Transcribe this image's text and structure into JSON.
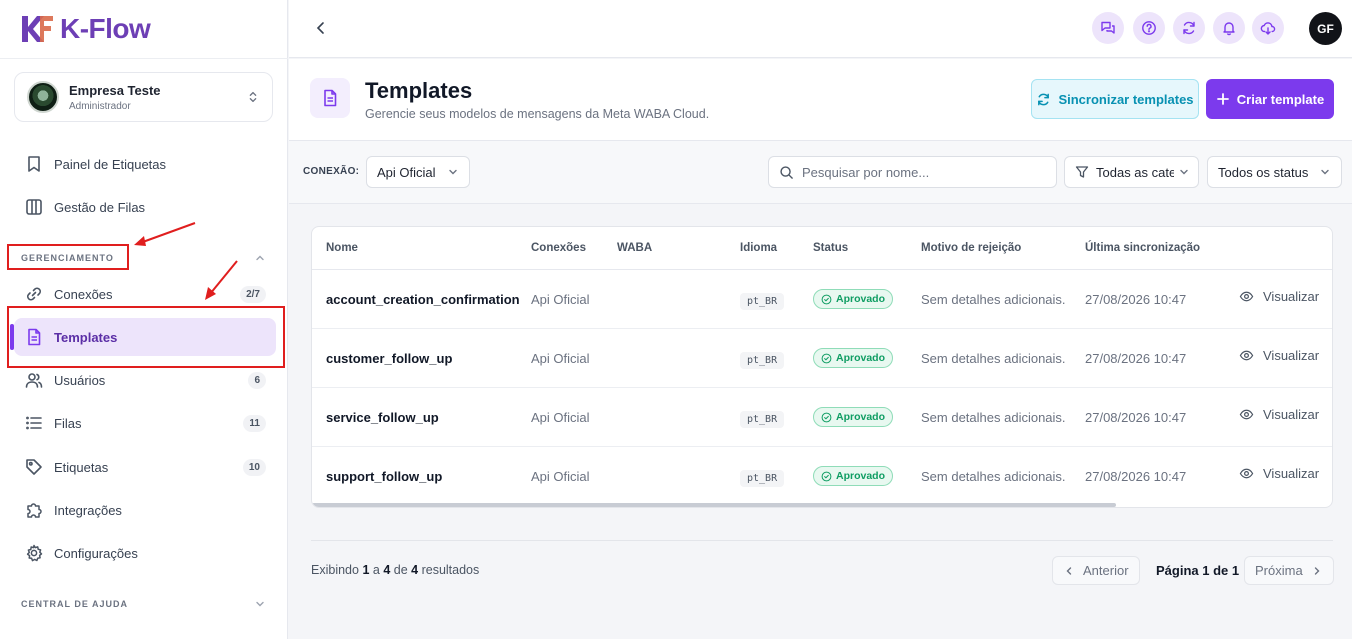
{
  "app": {
    "logo_text": "K-Flow"
  },
  "company": {
    "name": "Empresa Teste",
    "role": "Administrador"
  },
  "sidebar": {
    "top_items": [
      {
        "label": "Painel de Etiquetas",
        "icon": "bookmark-icon"
      },
      {
        "label": "Gestão de Filas",
        "icon": "columns-icon"
      }
    ],
    "section_management": "GERENCIAMENTO",
    "items": [
      {
        "label": "Conexões",
        "badge": "2/7",
        "icon": "link-icon"
      },
      {
        "label": "Templates",
        "badge": "",
        "icon": "document-icon",
        "active": true
      },
      {
        "label": "Usuários",
        "badge": "6",
        "icon": "users-icon"
      },
      {
        "label": "Filas",
        "badge": "11",
        "icon": "list-icon"
      },
      {
        "label": "Etiquetas",
        "badge": "10",
        "icon": "tag-icon"
      },
      {
        "label": "Integrações",
        "badge": "",
        "icon": "puzzle-icon"
      },
      {
        "label": "Configurações",
        "badge": "",
        "icon": "gear-icon"
      }
    ],
    "section_help": "CENTRAL DE AJUDA"
  },
  "topbar": {
    "user_initials": "GF"
  },
  "page": {
    "title": "Templates",
    "subtitle": "Gerencie seus modelos de mensagens da Meta WABA Cloud.",
    "sync_button": "Sincronizar templates",
    "create_button": "Criar template"
  },
  "filters": {
    "connection_label": "CONEXÃO:",
    "connection_value": "Api Oficial",
    "search_placeholder": "Pesquisar por nome...",
    "category_value": "Todas as categorias",
    "status_value": "Todos os status"
  },
  "table": {
    "headers": [
      "Nome",
      "Conexões",
      "WABA",
      "Idioma",
      "Status",
      "Motivo de rejeição",
      "Última sincronização"
    ],
    "rows": [
      {
        "name": "account_creation_confirmation",
        "connection": "Api Oficial",
        "waba": "",
        "language": "pt_BR",
        "status": "Aprovado",
        "reason": "Sem detalhes adicionais.",
        "last_sync": "27/08/2026 10:47",
        "action": "Visualizar"
      },
      {
        "name": "customer_follow_up",
        "connection": "Api Oficial",
        "waba": "",
        "language": "pt_BR",
        "status": "Aprovado",
        "reason": "Sem detalhes adicionais.",
        "last_sync": "27/08/2026 10:47",
        "action": "Visualizar"
      },
      {
        "name": "service_follow_up",
        "connection": "Api Oficial",
        "waba": "",
        "language": "pt_BR",
        "status": "Aprovado",
        "reason": "Sem detalhes adicionais.",
        "last_sync": "27/08/2026 10:47",
        "action": "Visualizar"
      },
      {
        "name": "support_follow_up",
        "connection": "Api Oficial",
        "waba": "",
        "language": "pt_BR",
        "status": "Aprovado",
        "reason": "Sem detalhes adicionais.",
        "last_sync": "27/08/2026 10:47",
        "action": "Visualizar"
      }
    ]
  },
  "pagination": {
    "showing_prefix": "Exibindo",
    "from": "1",
    "to_word": "a",
    "to": "4",
    "of_word": "de",
    "total": "4",
    "suffix": "resultados",
    "prev": "Anterior",
    "page_label": "Página 1 de 1",
    "next": "Próxima"
  },
  "colors": {
    "brand": "#7c3aed",
    "active_bg": "#ede4fb",
    "sync_accent": "#0891b2",
    "success": "#0f9d63",
    "annotation": "#e01e1e"
  }
}
